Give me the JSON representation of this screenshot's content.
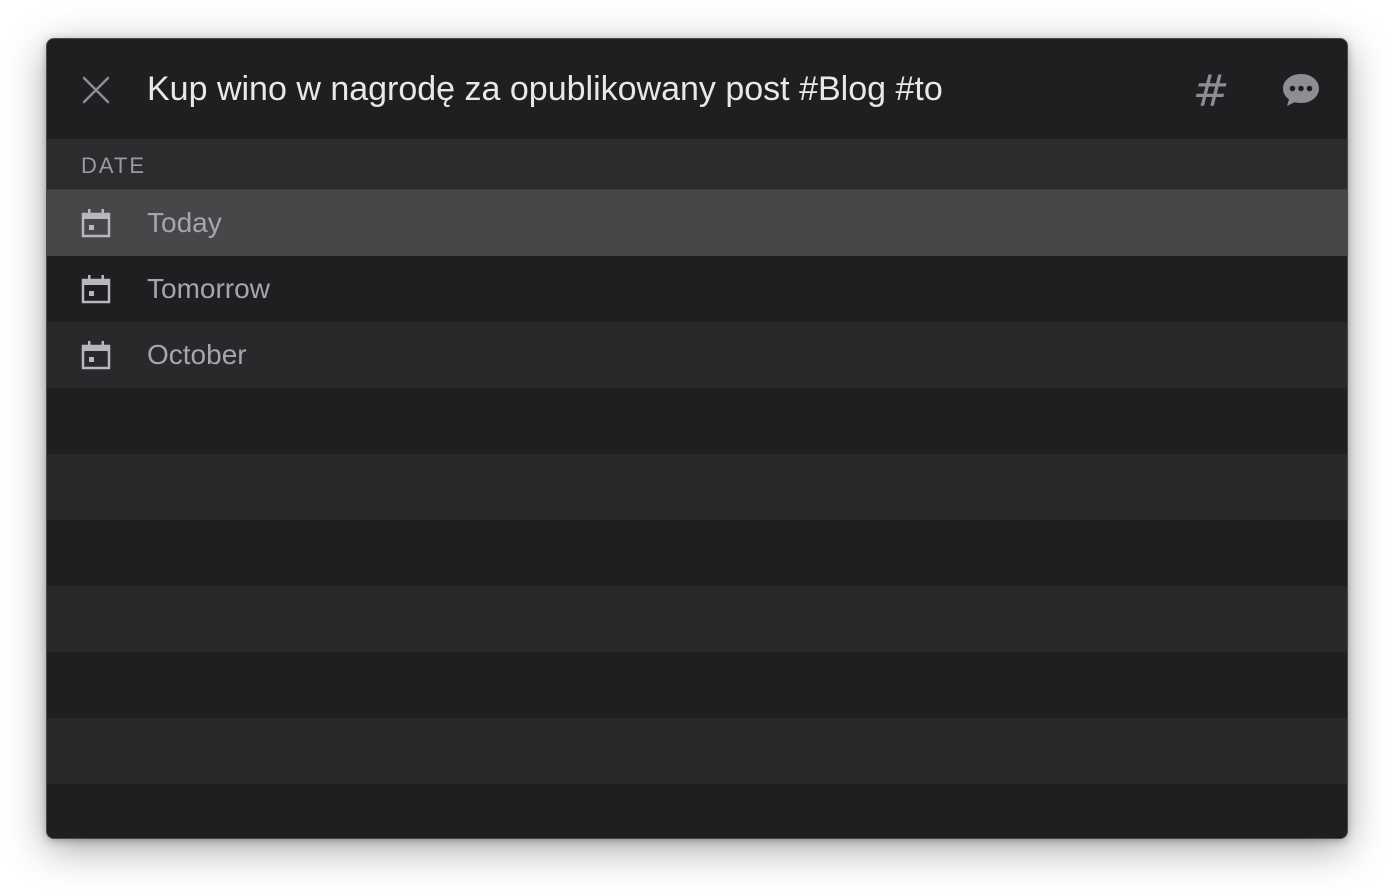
{
  "header": {
    "task_text": "Kup wino w nagrodę za opublikowany post #Blog #to",
    "close_icon": "close-icon",
    "hash_label": "#",
    "comment_icon": "comment-bubble-icon"
  },
  "section": {
    "label": "DATE"
  },
  "date_options": [
    {
      "label": "Today",
      "icon": "calendar-icon",
      "selected": true
    },
    {
      "label": "Tomorrow",
      "icon": "calendar-icon",
      "selected": false
    },
    {
      "label": "October",
      "icon": "calendar-icon",
      "selected": false
    }
  ],
  "colors": {
    "window_bg": "#1f1f21",
    "row_alt_bg": "#29292b",
    "selected_bg": "#474749",
    "section_bg": "#2c2c2e",
    "text_primary": "#e8e8ea",
    "text_secondary": "#a6a6aa",
    "icon": "#8e8e92"
  }
}
